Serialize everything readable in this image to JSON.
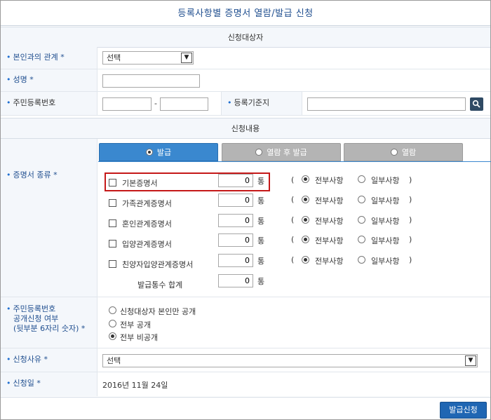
{
  "title": "등록사항별 증명서 열람/발급 신청",
  "section_target": "신청대상자",
  "section_content": "신청내용",
  "relation": {
    "label": "본인과의 관계 *",
    "value": "선택"
  },
  "name": {
    "label": "성명 *",
    "value": ""
  },
  "rrn": {
    "label": "주민등록번호",
    "dash": "-"
  },
  "base_place": {
    "label": "등록기준지"
  },
  "tabs": [
    "발급",
    "열람 후 발급",
    "열람"
  ],
  "cert": {
    "label": "증명서 종류 *",
    "unit": "통",
    "paren_open": "(",
    "paren_close": ")",
    "all_label": "전부사항",
    "part_label": "일부사항",
    "items": [
      {
        "name": "기본증명서",
        "count": "0"
      },
      {
        "name": "가족관계증명서",
        "count": "0"
      },
      {
        "name": "혼인관계증명서",
        "count": "0"
      },
      {
        "name": "입양관계증명서",
        "count": "0"
      },
      {
        "name": "친양자입양관계증명서",
        "count": "0"
      }
    ],
    "total_label": "발급통수 합계",
    "total_count": "0"
  },
  "disclosure": {
    "label_1": "주민등록번호",
    "label_2": "공개신청 여부",
    "label_3": "(뒷부분 6자리 숫자) *",
    "options": [
      "신청대상자 본인만 공개",
      "전부 공개",
      "전부 비공개"
    ],
    "selected": 2
  },
  "reason": {
    "label": "신청사유 *",
    "value": "선택"
  },
  "date": {
    "label": "신청일 *",
    "value": "2016년 11월 24일"
  },
  "submit_label": "발급신청"
}
